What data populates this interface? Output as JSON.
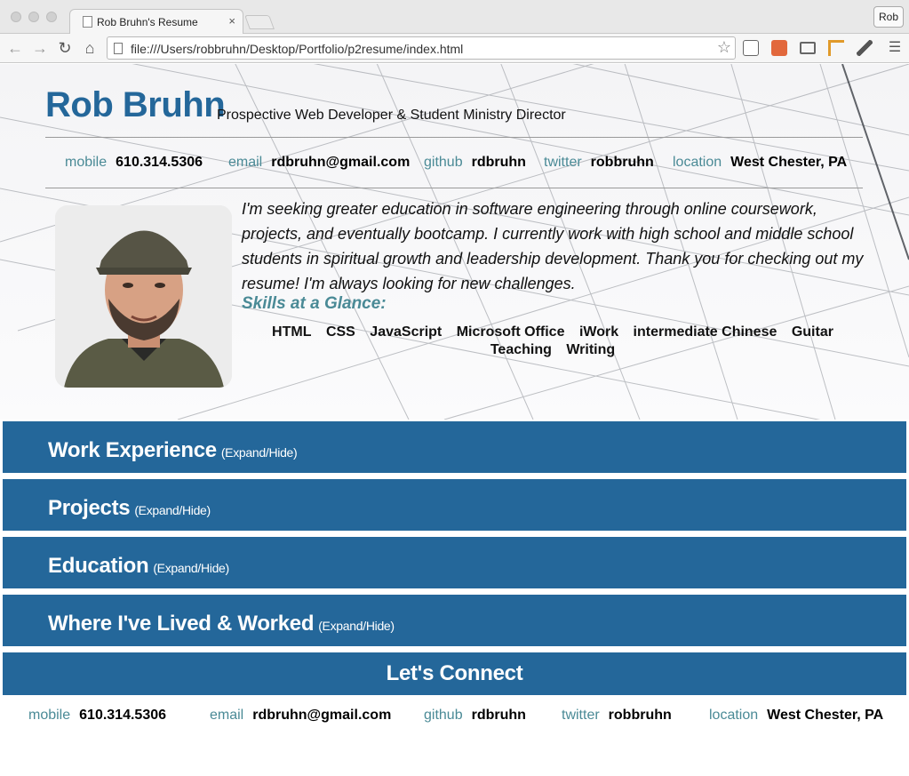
{
  "browser": {
    "tab_title": "Rob Bruhn's Resume",
    "tab_close": "×",
    "profile_label": "Rob",
    "url": "file:///Users/robbruhn/Desktop/Portfolio/p2resume/index.html",
    "icons": [
      "back-icon",
      "forward-icon",
      "reload-icon",
      "home-icon",
      "star-icon",
      "menu-icon"
    ]
  },
  "header": {
    "name": "Rob Bruhn",
    "role": "Prospective Web Developer & Student Ministry Director"
  },
  "contacts": [
    {
      "label": "mobile",
      "value": "610.314.5306"
    },
    {
      "label": "email",
      "value": "rdbruhn@gmail.com"
    },
    {
      "label": "github",
      "value": "rdbruhn"
    },
    {
      "label": "twitter",
      "value": "robbruhn"
    },
    {
      "label": "location",
      "value": "West Chester, PA"
    }
  ],
  "bio": "I'm seeking greater education in software engineering through online coursework, projects, and eventually bootcamp. I currently work with high school and middle school students in spiritual growth and leadership development. Thank you for checking out my resume! I'm always looking for new challenges.",
  "skills": {
    "title": "Skills at a Glance:",
    "items": [
      "HTML",
      "CSS",
      "JavaScript",
      "Microsoft Office",
      "iWork",
      "intermediate Chinese",
      "Guitar",
      "Teaching",
      "Writing"
    ]
  },
  "sections": [
    {
      "title": "Work Experience",
      "toggle": "(Expand/Hide)"
    },
    {
      "title": "Projects",
      "toggle": "(Expand/Hide)"
    },
    {
      "title": "Education",
      "toggle": "(Expand/Hide)"
    },
    {
      "title": "Where I've Lived & Worked",
      "toggle": "(Expand/Hide)"
    }
  ],
  "connect": {
    "title": "Let's Connect"
  },
  "colors": {
    "brand_blue": "#24679a",
    "label_teal": "#4a8a96"
  }
}
